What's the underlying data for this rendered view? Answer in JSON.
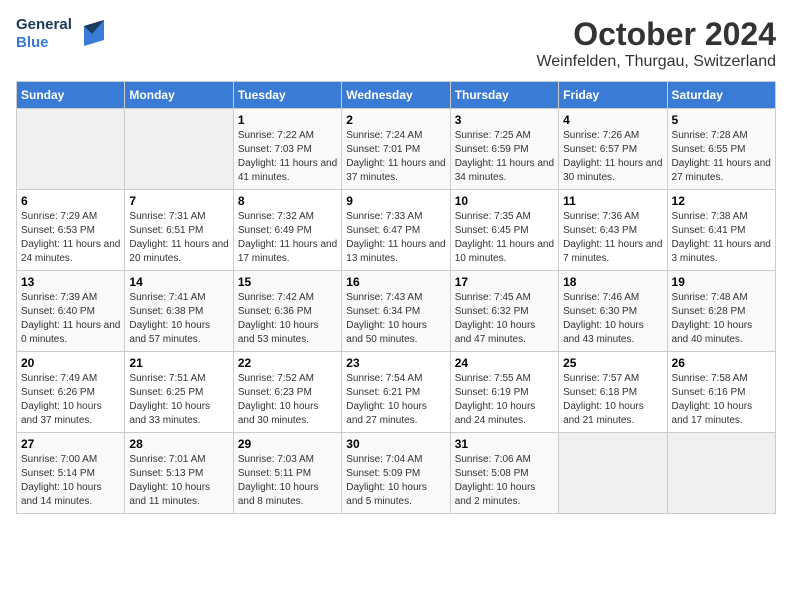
{
  "header": {
    "logo_text_general": "General",
    "logo_text_blue": "Blue",
    "month": "October 2024",
    "location": "Weinfelden, Thurgau, Switzerland"
  },
  "weekdays": [
    "Sunday",
    "Monday",
    "Tuesday",
    "Wednesday",
    "Thursday",
    "Friday",
    "Saturday"
  ],
  "weeks": [
    [
      {
        "day": "",
        "detail": ""
      },
      {
        "day": "",
        "detail": ""
      },
      {
        "day": "1",
        "detail": "Sunrise: 7:22 AM\nSunset: 7:03 PM\nDaylight: 11 hours and 41 minutes."
      },
      {
        "day": "2",
        "detail": "Sunrise: 7:24 AM\nSunset: 7:01 PM\nDaylight: 11 hours and 37 minutes."
      },
      {
        "day": "3",
        "detail": "Sunrise: 7:25 AM\nSunset: 6:59 PM\nDaylight: 11 hours and 34 minutes."
      },
      {
        "day": "4",
        "detail": "Sunrise: 7:26 AM\nSunset: 6:57 PM\nDaylight: 11 hours and 30 minutes."
      },
      {
        "day": "5",
        "detail": "Sunrise: 7:28 AM\nSunset: 6:55 PM\nDaylight: 11 hours and 27 minutes."
      }
    ],
    [
      {
        "day": "6",
        "detail": "Sunrise: 7:29 AM\nSunset: 6:53 PM\nDaylight: 11 hours and 24 minutes."
      },
      {
        "day": "7",
        "detail": "Sunrise: 7:31 AM\nSunset: 6:51 PM\nDaylight: 11 hours and 20 minutes."
      },
      {
        "day": "8",
        "detail": "Sunrise: 7:32 AM\nSunset: 6:49 PM\nDaylight: 11 hours and 17 minutes."
      },
      {
        "day": "9",
        "detail": "Sunrise: 7:33 AM\nSunset: 6:47 PM\nDaylight: 11 hours and 13 minutes."
      },
      {
        "day": "10",
        "detail": "Sunrise: 7:35 AM\nSunset: 6:45 PM\nDaylight: 11 hours and 10 minutes."
      },
      {
        "day": "11",
        "detail": "Sunrise: 7:36 AM\nSunset: 6:43 PM\nDaylight: 11 hours and 7 minutes."
      },
      {
        "day": "12",
        "detail": "Sunrise: 7:38 AM\nSunset: 6:41 PM\nDaylight: 11 hours and 3 minutes."
      }
    ],
    [
      {
        "day": "13",
        "detail": "Sunrise: 7:39 AM\nSunset: 6:40 PM\nDaylight: 11 hours and 0 minutes."
      },
      {
        "day": "14",
        "detail": "Sunrise: 7:41 AM\nSunset: 6:38 PM\nDaylight: 10 hours and 57 minutes."
      },
      {
        "day": "15",
        "detail": "Sunrise: 7:42 AM\nSunset: 6:36 PM\nDaylight: 10 hours and 53 minutes."
      },
      {
        "day": "16",
        "detail": "Sunrise: 7:43 AM\nSunset: 6:34 PM\nDaylight: 10 hours and 50 minutes."
      },
      {
        "day": "17",
        "detail": "Sunrise: 7:45 AM\nSunset: 6:32 PM\nDaylight: 10 hours and 47 minutes."
      },
      {
        "day": "18",
        "detail": "Sunrise: 7:46 AM\nSunset: 6:30 PM\nDaylight: 10 hours and 43 minutes."
      },
      {
        "day": "19",
        "detail": "Sunrise: 7:48 AM\nSunset: 6:28 PM\nDaylight: 10 hours and 40 minutes."
      }
    ],
    [
      {
        "day": "20",
        "detail": "Sunrise: 7:49 AM\nSunset: 6:26 PM\nDaylight: 10 hours and 37 minutes."
      },
      {
        "day": "21",
        "detail": "Sunrise: 7:51 AM\nSunset: 6:25 PM\nDaylight: 10 hours and 33 minutes."
      },
      {
        "day": "22",
        "detail": "Sunrise: 7:52 AM\nSunset: 6:23 PM\nDaylight: 10 hours and 30 minutes."
      },
      {
        "day": "23",
        "detail": "Sunrise: 7:54 AM\nSunset: 6:21 PM\nDaylight: 10 hours and 27 minutes."
      },
      {
        "day": "24",
        "detail": "Sunrise: 7:55 AM\nSunset: 6:19 PM\nDaylight: 10 hours and 24 minutes."
      },
      {
        "day": "25",
        "detail": "Sunrise: 7:57 AM\nSunset: 6:18 PM\nDaylight: 10 hours and 21 minutes."
      },
      {
        "day": "26",
        "detail": "Sunrise: 7:58 AM\nSunset: 6:16 PM\nDaylight: 10 hours and 17 minutes."
      }
    ],
    [
      {
        "day": "27",
        "detail": "Sunrise: 7:00 AM\nSunset: 5:14 PM\nDaylight: 10 hours and 14 minutes."
      },
      {
        "day": "28",
        "detail": "Sunrise: 7:01 AM\nSunset: 5:13 PM\nDaylight: 10 hours and 11 minutes."
      },
      {
        "day": "29",
        "detail": "Sunrise: 7:03 AM\nSunset: 5:11 PM\nDaylight: 10 hours and 8 minutes."
      },
      {
        "day": "30",
        "detail": "Sunrise: 7:04 AM\nSunset: 5:09 PM\nDaylight: 10 hours and 5 minutes."
      },
      {
        "day": "31",
        "detail": "Sunrise: 7:06 AM\nSunset: 5:08 PM\nDaylight: 10 hours and 2 minutes."
      },
      {
        "day": "",
        "detail": ""
      },
      {
        "day": "",
        "detail": ""
      }
    ]
  ]
}
